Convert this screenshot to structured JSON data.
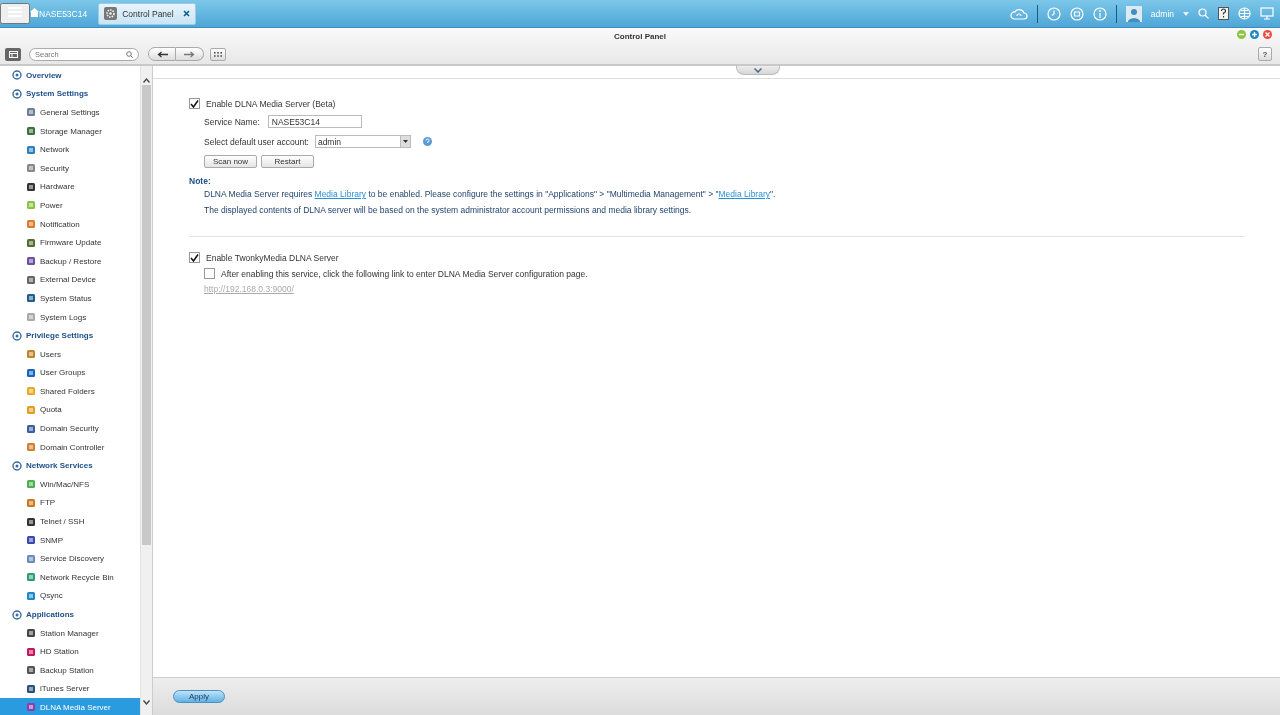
{
  "top_bar": {
    "home_tab": "NASE53C14",
    "app_tab": {
      "label": "Control Panel",
      "selected": true
    },
    "user": "admin"
  },
  "window": {
    "title": "Control Panel",
    "help_label": "?"
  },
  "search": {
    "placeholder": "Search"
  },
  "sidebar": {
    "items": [
      {
        "label": "Overview",
        "selected": false
      },
      {
        "label": "System Settings",
        "selected": false,
        "children": [
          {
            "label": "General Settings",
            "selected": false
          },
          {
            "label": "Storage Manager",
            "selected": false
          },
          {
            "label": "Network",
            "selected": false
          },
          {
            "label": "Security",
            "selected": false
          },
          {
            "label": "Hardware",
            "selected": false
          },
          {
            "label": "Power",
            "selected": false
          },
          {
            "label": "Notification",
            "selected": false
          },
          {
            "label": "Firmware Update",
            "selected": false
          },
          {
            "label": "Backup / Restore",
            "selected": false
          },
          {
            "label": "External Device",
            "selected": false
          },
          {
            "label": "System Status",
            "selected": false
          },
          {
            "label": "System Logs",
            "selected": false
          }
        ]
      },
      {
        "label": "Privilege Settings",
        "selected": false,
        "children": [
          {
            "label": "Users",
            "selected": false
          },
          {
            "label": "User Groups",
            "selected": false
          },
          {
            "label": "Shared Folders",
            "selected": false
          },
          {
            "label": "Quota",
            "selected": false
          },
          {
            "label": "Domain Security",
            "selected": false
          },
          {
            "label": "Domain Controller",
            "selected": false
          }
        ]
      },
      {
        "label": "Network Services",
        "selected": false,
        "children": [
          {
            "label": "Win/Mac/NFS",
            "selected": false
          },
          {
            "label": "FTP",
            "selected": false
          },
          {
            "label": "Telnet / SSH",
            "selected": false
          },
          {
            "label": "SNMP",
            "selected": false
          },
          {
            "label": "Service Discovery",
            "selected": false
          },
          {
            "label": "Network Recycle Bin",
            "selected": false
          },
          {
            "label": "Qsync",
            "selected": false
          }
        ]
      },
      {
        "label": "Applications",
        "selected": false,
        "children": [
          {
            "label": "Station Manager",
            "selected": false
          },
          {
            "label": "HD Station",
            "selected": false
          },
          {
            "label": "Backup Station",
            "selected": false
          },
          {
            "label": "iTunes Server",
            "selected": false
          },
          {
            "label": "DLNA Media Server",
            "selected": true
          }
        ]
      }
    ]
  },
  "content": {
    "enable_dlna": {
      "label": "Enable DLNA Media Server (Beta)",
      "checked": true
    },
    "service_name": {
      "label": "Service Name:",
      "value": "NASE53C14"
    },
    "default_account": {
      "label": "Select default user account:",
      "value": "admin"
    },
    "buttons": [
      "Scan now",
      "Restart"
    ],
    "note": {
      "title": "Note:",
      "parts": [
        {
          "text": "DLNA Media Server requires ",
          "kind": "text"
        },
        {
          "text": "Media Library",
          "kind": "link"
        },
        {
          "text": " to be enabled. Please configure the settings in \"Applications\" > \"Multimedia Management\" > \"",
          "kind": "text"
        },
        {
          "text": "Media Library",
          "kind": "link"
        },
        {
          "text": "\".",
          "kind": "text"
        }
      ],
      "detail": "The displayed contents of DLNA server will be based on the system administrator account permissions and media library settings."
    },
    "enable_twonky": {
      "label": "Enable TwonkyMedia DLNA Server",
      "checked": true
    },
    "twonky_hint": {
      "label": "After enabling this service, click the following link to enter DLNA Media Server configuration page.",
      "checked": false
    },
    "config_link": {
      "text": "http://192.168.0.3:9000/",
      "disabled": true
    }
  },
  "footer": {
    "apply": "Apply"
  }
}
